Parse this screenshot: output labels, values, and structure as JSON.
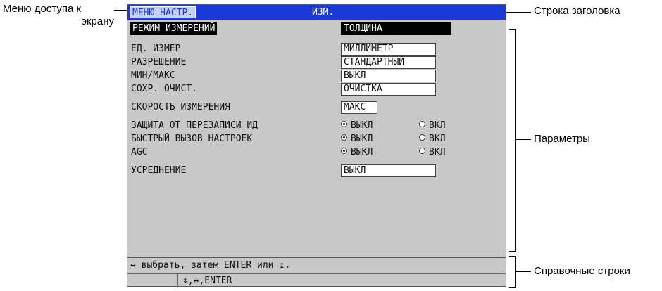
{
  "callouts": {
    "menu_access_line1": "Меню доступа к",
    "menu_access_line2": "экрану",
    "title_bar": "Строка заголовка",
    "parameters": "Параметры",
    "help_lines": "Справочные строки"
  },
  "screen": {
    "menu_tab": "МЕНЮ НАСТР.",
    "title": "ИЗМ.",
    "params": {
      "measure_mode": {
        "label": "РЕЖИМ ИЗМЕРЕНИЙ",
        "value": "ТОЛЩИНА"
      },
      "units": {
        "label": "ЕД. ИЗМЕР",
        "value": "МИЛЛИМЕТР"
      },
      "resolution": {
        "label": "РАЗРЕШЕНИЕ",
        "value": "СТАНДАРТНЫЙ"
      },
      "min_max": {
        "label": "МИН/МАКС",
        "value": "ВЫКЛ"
      },
      "save_clear": {
        "label": "СОХР. ОЧИСТ.",
        "value": "ОЧИСТКА"
      },
      "meas_speed": {
        "label": "СКОРОСТЬ ИЗМЕРЕНИЯ",
        "value": "МАКС"
      },
      "id_overwrite": {
        "label": "ЗАЩИТА ОТ ПЕРЕЗАПИСИ ИД",
        "opt_off": "ВЫКЛ",
        "opt_on": "ВКЛ",
        "selected": "off"
      },
      "quick_recall": {
        "label": "БЫСТРЫЙ ВЫЗОВ НАСТРОЕК",
        "opt_off": "ВЫКЛ",
        "opt_on": "ВКЛ",
        "selected": "off"
      },
      "agc": {
        "label": "AGC",
        "opt_off": "ВЫКЛ",
        "opt_on": "ВКЛ",
        "selected": "off"
      },
      "averaging": {
        "label": "УСРЕДНЕНИЕ",
        "value": "ВЫКЛ"
      }
    },
    "help": {
      "line1": "↔ выбрать, затем ENTER или ↨.",
      "line2": "↨,↔,ENTER"
    }
  },
  "colors": {
    "title_bar": "#1b39d6",
    "screen_bg": "#c8c8c8",
    "selection": "#000000"
  }
}
